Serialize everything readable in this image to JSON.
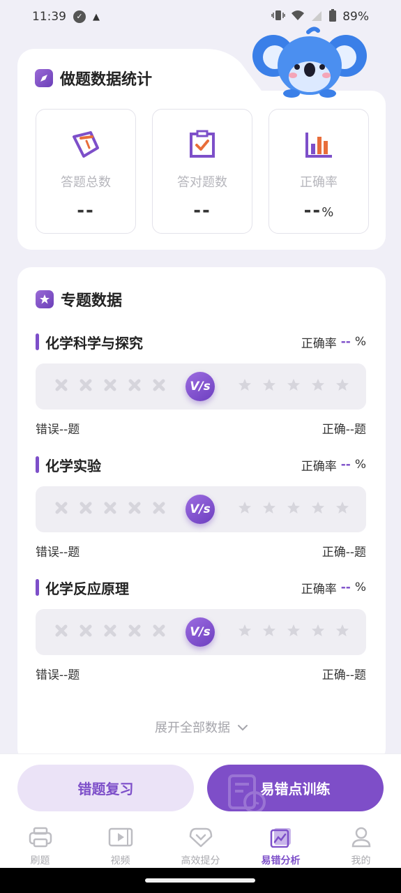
{
  "status_bar": {
    "time": "11:39",
    "battery": "89%"
  },
  "stats": {
    "title": "做题数据统计",
    "items": [
      {
        "label": "答题总数",
        "value": "--",
        "unit": ""
      },
      {
        "label": "答对题数",
        "value": "--",
        "unit": ""
      },
      {
        "label": "正确率",
        "value": "--",
        "unit": "%"
      }
    ]
  },
  "topics": {
    "title": "专题数据",
    "rate_label": "正确率",
    "rate_value": "--",
    "rate_unit": "%",
    "vs_label": "V/s",
    "items": [
      {
        "name": "化学科学与探究",
        "wrong": "错误--题",
        "right": "正确--题"
      },
      {
        "name": "化学实验",
        "wrong": "错误--题",
        "right": "正确--题"
      },
      {
        "name": "化学反应原理",
        "wrong": "错误--题",
        "right": "正确--题"
      }
    ],
    "expand_label": "展开全部数据"
  },
  "actions": {
    "review_label": "错题复习",
    "train_label": "易错点训练"
  },
  "tabs": [
    {
      "label": "刷题",
      "icon": "practice-icon",
      "active": false
    },
    {
      "label": "视频",
      "icon": "video-icon",
      "active": false
    },
    {
      "label": "高效提分",
      "icon": "boost-icon",
      "active": false
    },
    {
      "label": "易错分析",
      "icon": "analysis-icon",
      "active": true
    },
    {
      "label": "我的",
      "icon": "profile-icon",
      "active": false
    }
  ],
  "colors": {
    "accent": "#7d4fc9",
    "accent_light": "#ebe3f7",
    "background": "#f0eff7"
  }
}
